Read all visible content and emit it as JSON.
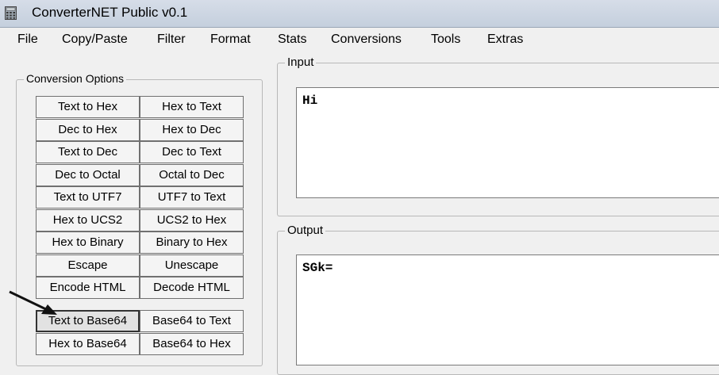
{
  "window": {
    "title": "ConverterNET Public v0.1"
  },
  "menu": [
    "File",
    "Copy/Paste",
    "Filter",
    "Format",
    "Stats",
    "Conversions",
    "Tools",
    "Extras"
  ],
  "conversion_options": {
    "label": "Conversion Options",
    "rows": [
      [
        "Text to Hex",
        "Hex to Text"
      ],
      [
        "Dec to Hex",
        "Hex to Dec"
      ],
      [
        "Text to Dec",
        "Dec to Text"
      ],
      [
        "Dec to Octal",
        "Octal to Dec"
      ],
      [
        "Text to UTF7",
        "UTF7 to Text"
      ],
      [
        "Hex to UCS2",
        "UCS2 to Hex"
      ],
      [
        "Hex to Binary",
        "Binary to Hex"
      ],
      [
        "Escape",
        "Unescape"
      ],
      [
        "Encode HTML",
        "Decode HTML"
      ],
      [
        "Text to Base64",
        "Base64 to Text"
      ],
      [
        "Hex to Base64",
        "Base64 to Hex"
      ]
    ]
  },
  "input": {
    "label": "Input",
    "value": "Hi"
  },
  "output": {
    "label": "Output",
    "value": "SGk="
  }
}
